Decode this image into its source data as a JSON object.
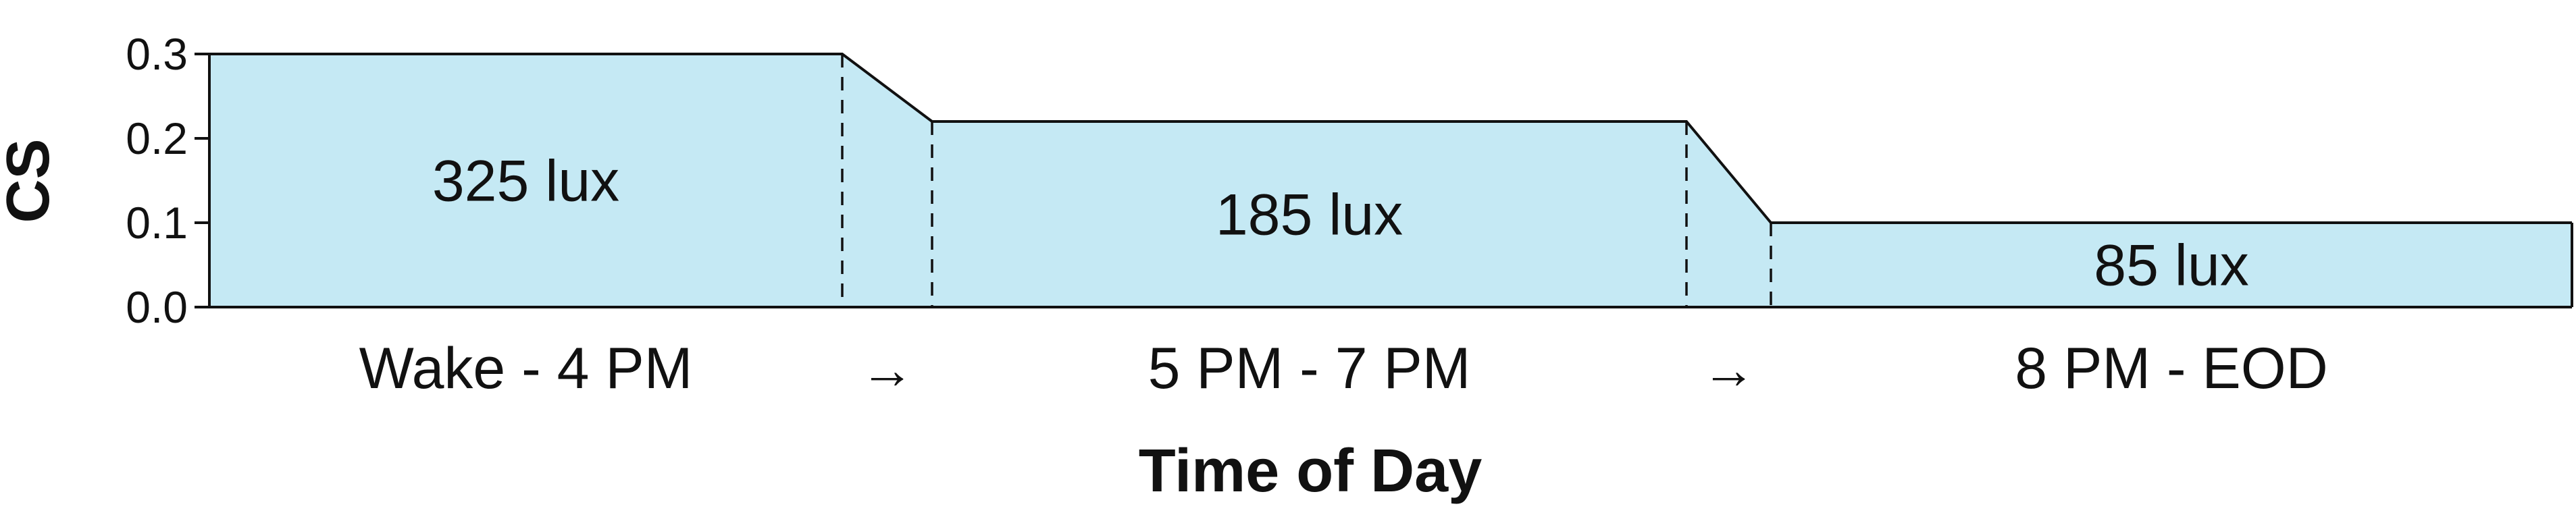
{
  "chart_data": {
    "type": "area",
    "title": "",
    "xlabel": "Time of Day",
    "ylabel": "CS",
    "ylim": [
      0.0,
      0.3
    ],
    "yticks": [
      "0.0",
      "0.1",
      "0.2",
      "0.3"
    ],
    "grid": false,
    "fill_color": "#c5e9f4",
    "line_color": "#111111",
    "segments": [
      {
        "category": "Wake - 4 PM",
        "value": 0.3,
        "label": "325 lux"
      },
      {
        "category": "5 PM - 7 PM",
        "value": 0.22,
        "label": "185 lux"
      },
      {
        "category": "8 PM - EOD",
        "value": 0.1,
        "label": "85 lux"
      }
    ],
    "transition_symbol": "→"
  }
}
